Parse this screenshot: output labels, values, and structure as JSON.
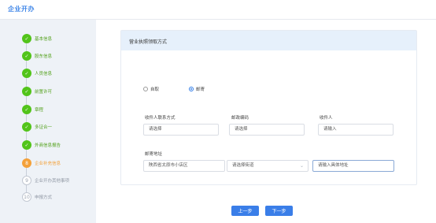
{
  "header": {
    "title": "企业开办"
  },
  "steps": [
    {
      "label": "基本信息",
      "status": "done",
      "marker": "✓"
    },
    {
      "label": "股东信息",
      "status": "done",
      "marker": "✓"
    },
    {
      "label": "人员信息",
      "status": "done",
      "marker": "✓"
    },
    {
      "label": "前置许可",
      "status": "done",
      "marker": "✓"
    },
    {
      "label": "章程",
      "status": "done",
      "marker": "✓"
    },
    {
      "label": "多证合一",
      "status": "done",
      "marker": "✓"
    },
    {
      "label": "外商信息报告",
      "status": "done",
      "marker": "✓"
    },
    {
      "label": "企业补充信息",
      "status": "active",
      "marker": "8"
    },
    {
      "label": "企业开办其他事项",
      "status": "todo",
      "marker": "9"
    },
    {
      "label": "申报方式",
      "status": "todo",
      "marker": "10"
    }
  ],
  "card": {
    "title": "营业执照领取方式",
    "options": [
      {
        "label": "自取",
        "selected": false
      },
      {
        "label": "邮寄",
        "selected": true
      }
    ],
    "fields": {
      "recipient_contact": {
        "label": "收件人联系方式",
        "value": "请选择"
      },
      "postal_code": {
        "label": "邮政编码",
        "value": "请选择"
      },
      "recipient": {
        "label": "收件人",
        "value": "请输入"
      },
      "address_label": "邮寄地址",
      "address_city": "陕西省太原市小店区",
      "address_street": "请选择街道",
      "address_detail": "请输入具体地址"
    }
  },
  "buttons": {
    "prev": "上一步",
    "next": "下一步"
  },
  "colors": {
    "accent": "#3a7ee8",
    "done": "#52c41a",
    "active": "#f4a13a",
    "header_bg": "#e6f0fb"
  }
}
